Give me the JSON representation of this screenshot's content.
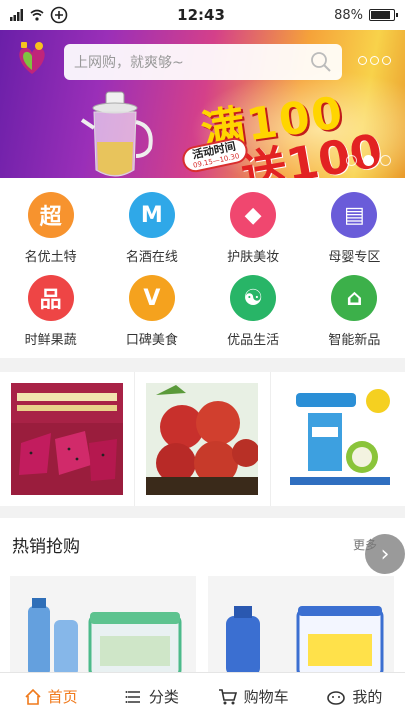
{
  "status_bar": {
    "time": "12:43",
    "battery": "88%",
    "battery_level": 0.88
  },
  "header": {
    "search_placeholder": "上网购，就爽够~"
  },
  "banner": {
    "promo_main": "满100",
    "promo_sub": "送100",
    "badge_title": "活动时间",
    "badge_dates": "09.15—10.30",
    "slides_count": 3,
    "active_slide": 1
  },
  "categories": [
    {
      "label": "名优土特",
      "glyph": "超",
      "color": "#f7932e"
    },
    {
      "label": "名酒在线",
      "glyph": "M",
      "color": "#2fa8e8"
    },
    {
      "label": "护肤美妆",
      "glyph": "◆",
      "color": "#f0476f"
    },
    {
      "label": "母婴专区",
      "glyph": "▤",
      "color": "#6a5cd9"
    },
    {
      "label": "时鲜果蔬",
      "glyph": "品",
      "color": "#ee4545"
    },
    {
      "label": "口碑美食",
      "glyph": "V",
      "color": "#f5a21e"
    },
    {
      "label": "优品生活",
      "glyph": "☯",
      "color": "#28b567"
    },
    {
      "label": "智能新品",
      "glyph": "⌂",
      "color": "#3cb04a"
    }
  ],
  "hot_section": {
    "title": "热销抢购",
    "more": "更多"
  },
  "tabbar": {
    "items": [
      {
        "label": "首页",
        "icon": "home-icon",
        "active": true
      },
      {
        "label": "分类",
        "icon": "list-icon",
        "active": false
      },
      {
        "label": "购物车",
        "icon": "cart-icon",
        "active": false
      },
      {
        "label": "我的",
        "icon": "user-icon",
        "active": false
      }
    ]
  },
  "colors": {
    "accent": "#f07a1c"
  }
}
